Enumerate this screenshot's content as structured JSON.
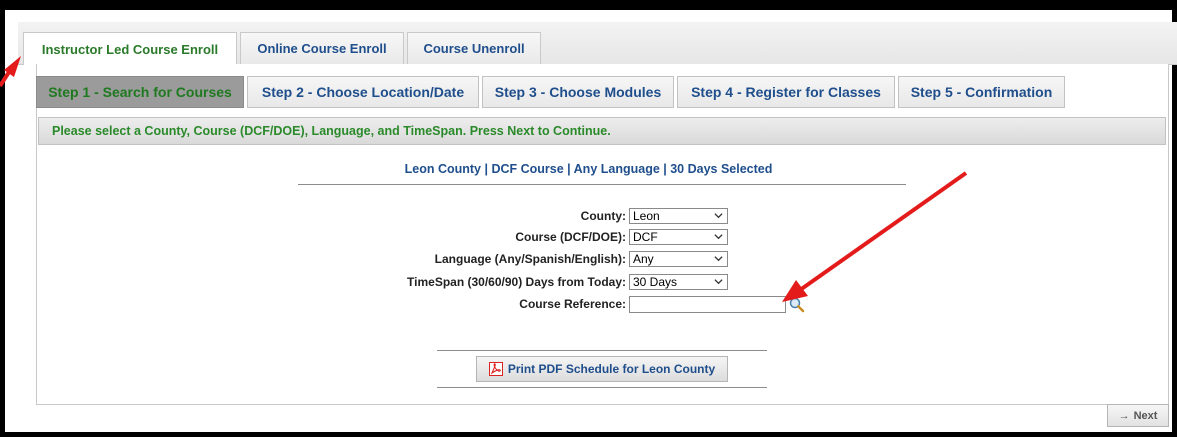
{
  "outer_tabs": [
    {
      "label": "Instructor Led Course Enroll",
      "active": true
    },
    {
      "label": "Online Course Enroll",
      "active": false
    },
    {
      "label": "Course Unenroll",
      "active": false
    }
  ],
  "steps": [
    {
      "label": "Step 1 - Search for Courses",
      "active": true
    },
    {
      "label": "Step 2 - Choose Location/Date",
      "active": false
    },
    {
      "label": "Step 3 - Choose Modules",
      "active": false
    },
    {
      "label": "Step 4 - Register for Classes",
      "active": false
    },
    {
      "label": "Step 5 - Confirmation",
      "active": false
    }
  ],
  "instruction": "Please select a County, Course (DCF/DOE), Language, and TimeSpan. Press Next to Continue.",
  "summary": "Leon County | DCF Course | Any Language | 30 Days Selected",
  "form": {
    "county": {
      "label": "County:",
      "value": "Leon"
    },
    "course": {
      "label": "Course (DCF/DOE):",
      "value": "DCF"
    },
    "language": {
      "label": "Language (Any/Spanish/English):",
      "value": "Any"
    },
    "timespan": {
      "label": "TimeSpan (30/60/90) Days from Today:",
      "value": "30 Days"
    },
    "reference": {
      "label": "Course Reference:",
      "value": ""
    }
  },
  "print_button": "Print PDF Schedule for Leon County",
  "next_button": "Next",
  "colors": {
    "active_tab_text": "#2a7a2a",
    "link_blue": "#1f4e8c",
    "annotation_arrow": "#e31b1b"
  }
}
